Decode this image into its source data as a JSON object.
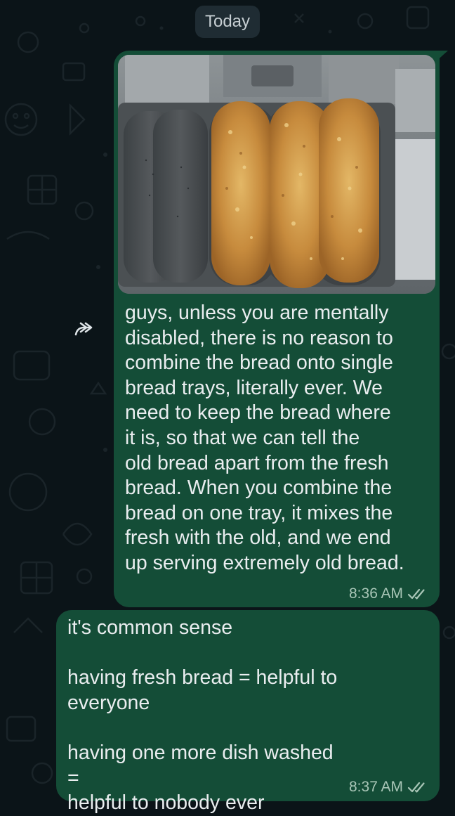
{
  "date_divider": "Today",
  "messages": [
    {
      "id": "msg-1",
      "has_image": true,
      "image_description_icon": "bread-tray-photo",
      "text": "guys, unless you are mentally\ndisabled, there is no reason to\ncombine the bread onto single\nbread trays, literally ever. We\nneed to keep the bread where\nit is, so that we can tell the\nold bread apart from the fresh\nbread. When you combine the\nbread on one tray, it mixes the\nfresh with the old, and we end\nup serving extremely old bread.",
      "time": "8:36 AM",
      "status_icon": "double-check-icon"
    },
    {
      "id": "msg-2",
      "has_image": false,
      "text": "it's common sense\n\nhaving fresh bread = helpful to\neveryone\n\nhaving one more dish washed =\nhelpful to nobody ever",
      "time": "8:37 AM",
      "status_icon": "double-check-icon"
    }
  ],
  "forward_icon": "forward-arrow-icon",
  "colors": {
    "background": "#0b1418",
    "bubble": "#144d37",
    "text": "#e9edef",
    "timestamp": "#a9c6b7",
    "date_chip": "#1f2c33"
  }
}
